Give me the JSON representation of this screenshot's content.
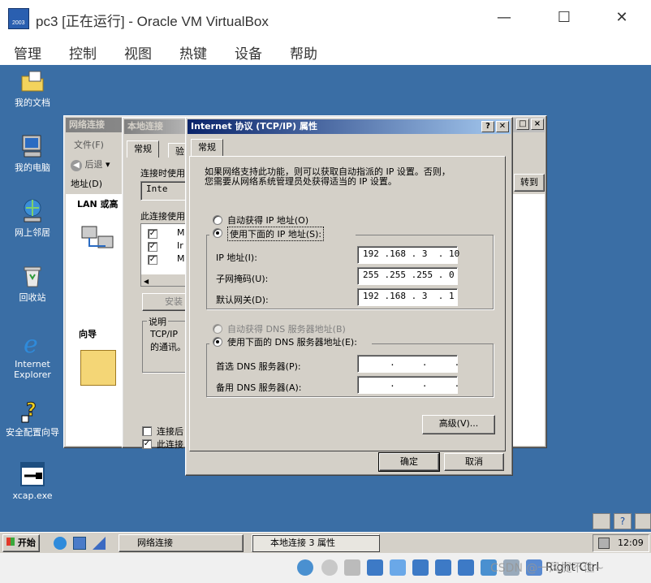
{
  "vbox": {
    "title": "pc3 [正在运行] - Oracle VM VirtualBox",
    "icon_text": "2003",
    "menu": [
      "管理",
      "控制",
      "视图",
      "热键",
      "设备",
      "帮助"
    ],
    "controls": {
      "minimize": "—",
      "maximize": "☐",
      "close": "✕"
    },
    "host_key": "Right Ctrl",
    "watermark": "CSDN @一风捉不住~"
  },
  "desktop": {
    "icons": [
      {
        "label": "我的文档",
        "icon": "folder-doc-icon"
      },
      {
        "label": "我的电脑",
        "icon": "computer-icon"
      },
      {
        "label": "网上邻居",
        "icon": "network-icon"
      },
      {
        "label": "回收站",
        "icon": "recycle-bin-icon"
      },
      {
        "label": "Internet Explorer",
        "icon": "ie-icon"
      },
      {
        "label": "安全配置向导",
        "icon": "security-wizard-icon"
      },
      {
        "label": "xcap.exe",
        "icon": "exe-icon"
      }
    ]
  },
  "net_window": {
    "title": "网络连接",
    "menu_file": "文件(F)",
    "back": "后退",
    "address_label": "地址(D)",
    "go": "转到",
    "lan_header": "LAN 或高",
    "wizard_header": "向导"
  },
  "lan_props": {
    "title": "本地连接",
    "tabs": [
      "常规",
      "验"
    ],
    "connect_using": "连接时使用",
    "adapter": "Inte",
    "items_label": "此连接使用",
    "items": [
      "Mi",
      "Ir",
      "Mi"
    ],
    "install": "安装",
    "desc_title": "说明",
    "desc_text": [
      "TCP/IP",
      "的通讯。"
    ],
    "chk1": "连接后",
    "chk2": "此连接"
  },
  "tcpip": {
    "title": "Internet 协议 (TCP/IP) 属性",
    "help_btn": "?",
    "close_btn": "✕",
    "tab": "常规",
    "intro": [
      "如果网络支持此功能，则可以获取自动指派的 IP 设置。否则，",
      "您需要从网络系统管理员处获得适当的 IP 设置。"
    ],
    "auto_ip": "自动获得 IP 地址(O)",
    "manual_ip": "使用下面的 IP 地址(S):",
    "ip_label": "IP 地址(I):",
    "ip_value": "192 .168 . 3  . 10",
    "mask_label": "子网掩码(U):",
    "mask_value": "255 .255 .255 . 0",
    "gw_label": "默认网关(D):",
    "gw_value": "192 .168 . 3  . 1",
    "auto_dns": "自动获得 DNS 服务器地址(B)",
    "manual_dns": "使用下面的 DNS 服务器地址(E):",
    "dns1_label": "首选 DNS 服务器(P):",
    "dns2_label": "备用 DNS 服务器(A):",
    "dns_empty": "     .     .     .",
    "advanced": "高级(V)...",
    "ok": "确定",
    "cancel": "取消"
  },
  "taskbar": {
    "start": "开始",
    "tasks": [
      "网络连接",
      "本地连接 3 属性"
    ],
    "clock": "12:09"
  }
}
